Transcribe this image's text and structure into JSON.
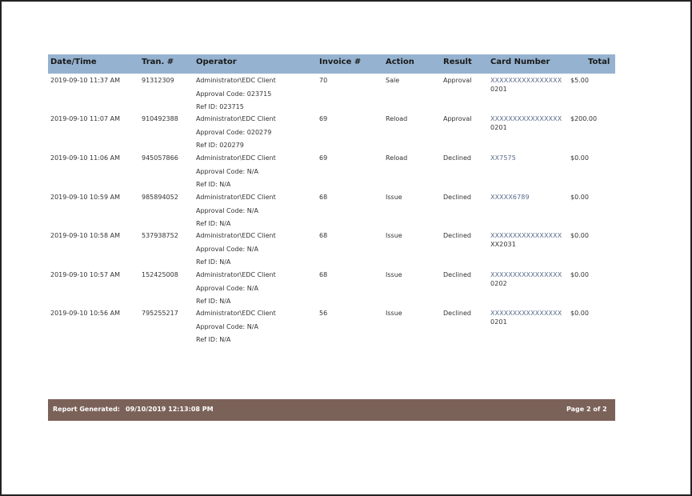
{
  "columns": {
    "datetime": "Date/Time",
    "tran": "Tran. #",
    "operator": "Operator",
    "invoice": "Invoice #",
    "action": "Action",
    "result": "Result",
    "card": "Card Number",
    "total": "Total"
  },
  "rows": [
    {
      "datetime": "2019-09-10 11:37 AM",
      "tran": "91312309",
      "operator": "Administrator\\EDC Client",
      "approval": "Approval Code: 023715",
      "ref": "Ref ID: 023715",
      "invoice": "70",
      "action": "Sale",
      "result": "Approval",
      "card1": "XXXXXXXXXXXXXXXX",
      "card2": "0201",
      "total": "$5.00"
    },
    {
      "datetime": "2019-09-10 11:07 AM",
      "tran": "910492388",
      "operator": "Administrator\\EDC Client",
      "approval": "Approval Code: 020279",
      "ref": "Ref ID: 020279",
      "invoice": "69",
      "action": "Reload",
      "result": "Approval",
      "card1": "XXXXXXXXXXXXXXXX",
      "card2": "0201",
      "total": "$200.00"
    },
    {
      "datetime": "2019-09-10 11:06 AM",
      "tran": "945057866",
      "operator": "Administrator\\EDC Client",
      "approval": "Approval Code: N/A",
      "ref": "Ref ID: N/A",
      "invoice": "69",
      "action": "Reload",
      "result": "Declined",
      "card1": "XX7575",
      "card2": "",
      "total": "$0.00"
    },
    {
      "datetime": "2019-09-10 10:59 AM",
      "tran": "985894052",
      "operator": "Administrator\\EDC Client",
      "approval": "Approval Code: N/A",
      "ref": "Ref ID: N/A",
      "invoice": "68",
      "action": "Issue",
      "result": "Declined",
      "card1": "XXXXX6789",
      "card2": "",
      "total": "$0.00"
    },
    {
      "datetime": "2019-09-10 10:58 AM",
      "tran": "537938752",
      "operator": "Administrator\\EDC Client",
      "approval": "Approval Code: N/A",
      "ref": "Ref ID: N/A",
      "invoice": "68",
      "action": "Issue",
      "result": "Declined",
      "card1": "XXXXXXXXXXXXXXXX",
      "card2": "XX2031",
      "total": "$0.00"
    },
    {
      "datetime": "2019-09-10 10:57 AM",
      "tran": "152425008",
      "operator": "Administrator\\EDC Client",
      "approval": "Approval Code: N/A",
      "ref": "Ref ID: N/A",
      "invoice": "68",
      "action": "Issue",
      "result": "Declined",
      "card1": "XXXXXXXXXXXXXXXX",
      "card2": "0202",
      "total": "$0.00"
    },
    {
      "datetime": "2019-09-10 10:56 AM",
      "tran": "795255217",
      "operator": "Administrator\\EDC Client",
      "approval": "Approval Code: N/A",
      "ref": "Ref ID: N/A",
      "invoice": "56",
      "action": "Issue",
      "result": "Declined",
      "card1": "XXXXXXXXXXXXXXXX",
      "card2": "0201",
      "total": "$0.00"
    }
  ],
  "footer": {
    "generated_label": "Report Generated:",
    "generated_value": "09/10/2019 12:13:08 PM",
    "page": "Page 2 of 2"
  },
  "colors": {
    "header_bg": "#95b3d0",
    "footer_bg": "#7b6259"
  }
}
